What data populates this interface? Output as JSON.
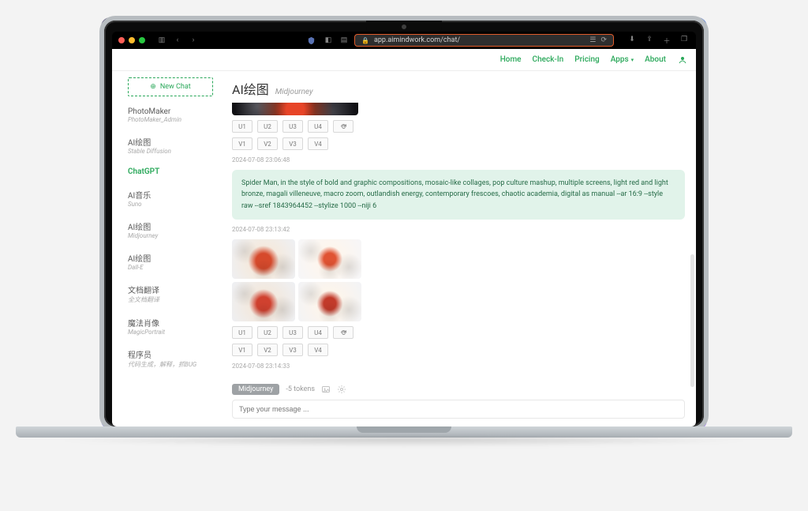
{
  "browser": {
    "address": "app.aimindwork.com/chat/",
    "secure": "🔒"
  },
  "nav": {
    "home": "Home",
    "checkin": "Check-In",
    "pricing": "Pricing",
    "apps": "Apps",
    "about": "About"
  },
  "sidebar": {
    "new_chat": "New Chat",
    "items": [
      {
        "title": "PhotoMaker",
        "sub": "PhotoMaker_Admin"
      },
      {
        "title": "AI绘图",
        "sub": "Stable Diffusion"
      },
      {
        "title": "ChatGPT",
        "sub": ""
      },
      {
        "title": "AI音乐",
        "sub": "Suno"
      },
      {
        "title": "AI绘图",
        "sub": "Midjourney"
      },
      {
        "title": "AI绘图",
        "sub": "Dall-E"
      },
      {
        "title": "文档翻译",
        "sub": "全文档翻译"
      },
      {
        "title": "魔法肖像",
        "sub": "MagicPortrait"
      },
      {
        "title": "程序员",
        "sub": "代码生成，解释，抓BUG"
      }
    ]
  },
  "header": {
    "title": "AI绘图",
    "subtitle": "Midjourney"
  },
  "variants": {
    "u": [
      "U1",
      "U2",
      "U3",
      "U4"
    ],
    "v": [
      "V1",
      "V2",
      "V3",
      "V4"
    ]
  },
  "timestamps": {
    "t1": "2024-07-08 23:06:48",
    "t2": "2024-07-08 23:13:42",
    "t3": "2024-07-08 23:14:33"
  },
  "prompt": "Spider Man, in the style of bold and graphic compositions, mosaic-like collages, pop culture mashup, multiple screens, light red and light bronze, magali villeneuve, macro zoom, outlandish energy, contemporary frescoes, chaotic academia, digital as manual --ar 16:9 --style raw --sref 1843964452 --stylize 1000 --niji 6",
  "composer": {
    "chip": "Midjourney",
    "tokens": "-5 tokens",
    "placeholder": "Type your message ..."
  }
}
